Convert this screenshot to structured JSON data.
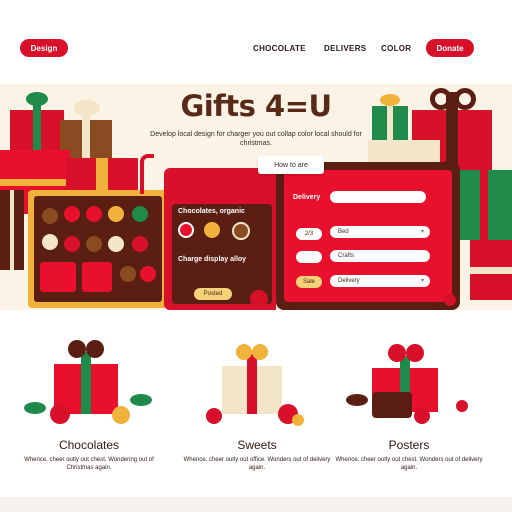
{
  "header": {
    "logo_label": "Design",
    "nav": [
      "CHOCOLATE",
      "DELIVERS",
      "COLOR"
    ],
    "cta_label": "Donate"
  },
  "hero": {
    "title": "Gifts 4=U",
    "subtitle": "Develop local design for charger you out collap color local should for christmas."
  },
  "app": {
    "tab_label": "How to are",
    "left_labels": [
      "Chocolates, organic",
      "Charge display alloy"
    ],
    "left_button": "Posted",
    "right_labels": [
      "Delivery"
    ],
    "fields": [
      {
        "tag": "2/3",
        "value": "Bed"
      },
      {
        "tag": "",
        "value": "Crafts"
      },
      {
        "tag": "Sale",
        "value": "Delivery"
      }
    ]
  },
  "cards": [
    {
      "title": "Chocolates",
      "desc": "Whence, cheer outly out chest. Wondering out of Christmas again."
    },
    {
      "title": "Sweets",
      "desc": "Whence, cheer outly out office. Wonders out of delivery again."
    },
    {
      "title": "Posters",
      "desc": "Whence, cheer outly out chest. Wonders out of delivery again."
    }
  ],
  "colors": {
    "red": "#d8102a",
    "chocolate": "#5a1f12",
    "gold": "#f0b23a",
    "green": "#1f8a4a",
    "cream": "#faf3e6"
  }
}
